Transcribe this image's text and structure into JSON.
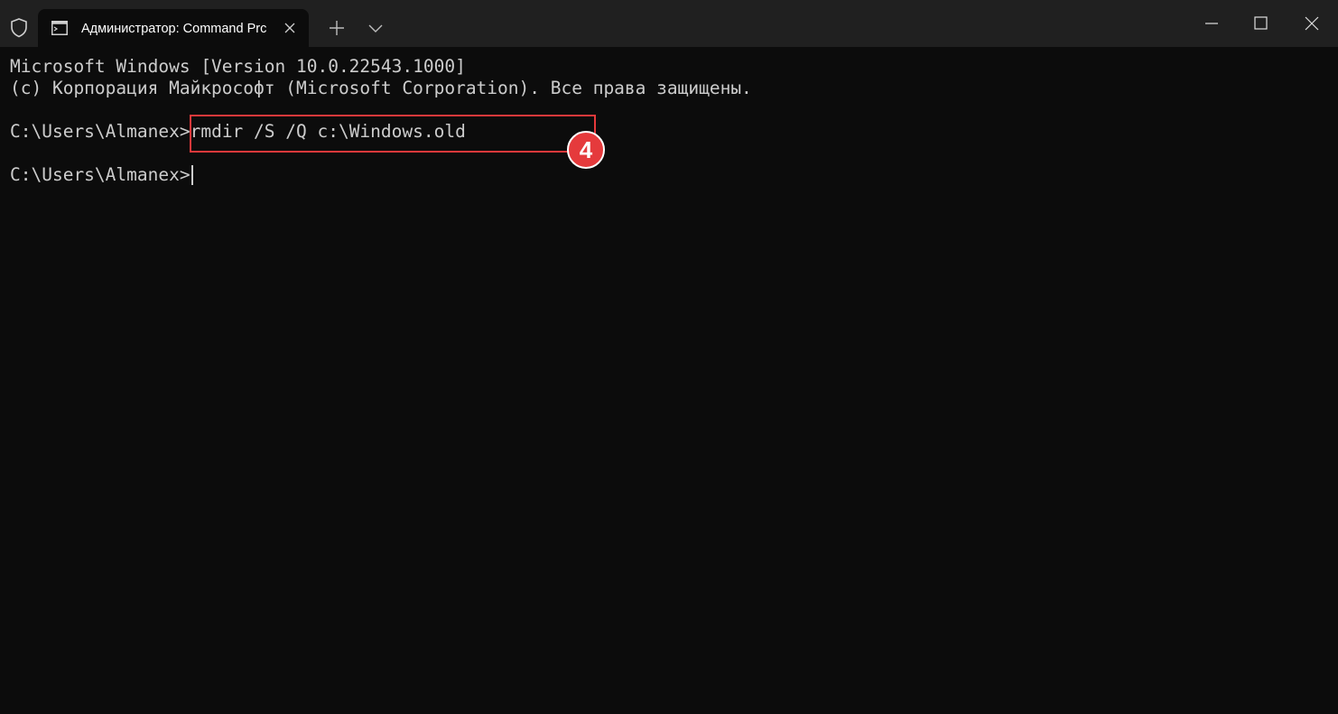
{
  "window": {
    "tab_title": "Администратор: Command Prc",
    "colors": {
      "titlebar": "#202020",
      "terminal_bg": "#0c0c0c",
      "text": "#cccccc",
      "annotation": "#e5393b"
    },
    "icons": {
      "shield": "shield-icon",
      "tab_icon": "cmd-icon",
      "tab_close": "close-icon",
      "new_tab": "plus-icon",
      "dropdown": "chevron-down-icon",
      "minimize": "minimize-icon",
      "maximize": "maximize-icon",
      "close": "close-icon"
    }
  },
  "terminal": {
    "version_line": "Microsoft Windows [Version 10.0.22543.1000]",
    "copyright_line": "(c) Корпорация Майкрософт (Microsoft Corporation). Все права защищены.",
    "prompt1": "C:\\Users\\Almanex>",
    "command": "rmdir /S /Q c:\\Windows.old",
    "prompt2": "C:\\Users\\Almanex>"
  },
  "annotation": {
    "step_number": "4"
  }
}
